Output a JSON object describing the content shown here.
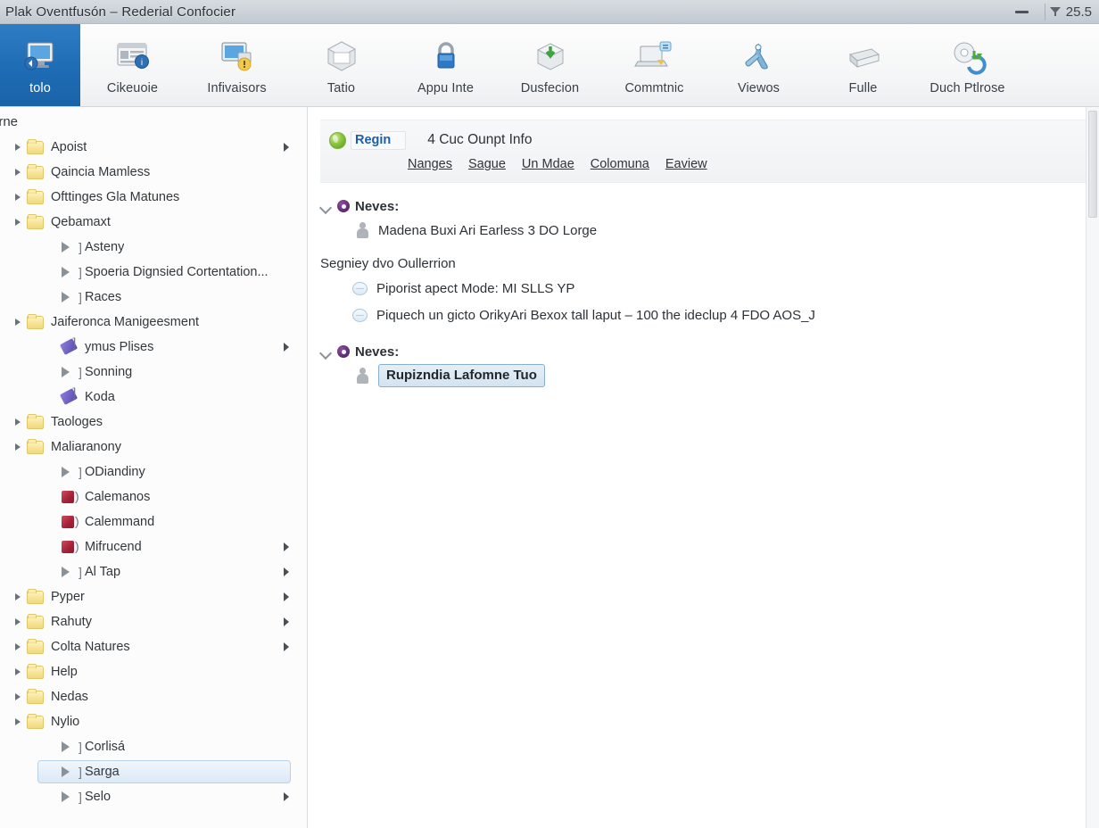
{
  "window": {
    "title": "Plak Oventfusón  –  Rederial Confocier",
    "minimize_label": "—",
    "zoom_value": "25.5",
    "filter_icon": "funnel-icon",
    "minimize_icon": "minimize-icon"
  },
  "toolbar": {
    "items": [
      {
        "label": "tolo",
        "icon": "monitor-blue-icon",
        "selected": true
      },
      {
        "label": "Cikeuoie",
        "icon": "document-info-icon",
        "selected": false
      },
      {
        "label": "Infivaisors",
        "icon": "monitor-alert-icon",
        "selected": false
      },
      {
        "label": "Tatio",
        "icon": "box-gray-icon",
        "selected": false
      },
      {
        "label": "Appu Inte",
        "icon": "lock-blue-icon",
        "selected": false
      },
      {
        "label": "Dusfecion",
        "icon": "box-download-icon",
        "selected": false
      },
      {
        "label": "Commtnic",
        "icon": "laptop-deploy-icon",
        "selected": false
      },
      {
        "label": "Viewos",
        "icon": "wrench-blue-icon",
        "selected": false
      },
      {
        "label": "Fulle",
        "icon": "server-gray-icon",
        "selected": false
      },
      {
        "label": "Duch Ptlrose",
        "icon": "disc-refresh-icon",
        "selected": false
      }
    ]
  },
  "sidebar": {
    "header": "erne",
    "nodes": [
      {
        "label": "Apoist",
        "icon": "folder-icon",
        "indent": 0,
        "twist": true,
        "arrow": true
      },
      {
        "label": "Qaincia Mamless",
        "icon": "folder-icon",
        "indent": 0,
        "twist": true,
        "arrow": false
      },
      {
        "label": "Ofttinges Gla Matunes",
        "icon": "folder-icon",
        "indent": 0,
        "twist": true,
        "arrow": false
      },
      {
        "label": "Qebamaxt",
        "icon": "folder-icon",
        "indent": 0,
        "twist": true,
        "arrow": false
      },
      {
        "label": "Asteny",
        "icon": "triangle-icon",
        "indent": 1,
        "twist": false,
        "arrow": false
      },
      {
        "label": "Spoeria Dignsied Cortentation...",
        "icon": "triangle-icon",
        "indent": 1,
        "twist": false,
        "arrow": false
      },
      {
        "label": "Races",
        "icon": "triangle-icon",
        "indent": 1,
        "twist": false,
        "arrow": false
      },
      {
        "label": "Jaiferonca Manigeesment",
        "icon": "folder-icon",
        "indent": 0,
        "twist": true,
        "arrow": false
      },
      {
        "label": "ymus Plises",
        "icon": "pen-icon",
        "indent": 1,
        "twist": false,
        "arrow": true
      },
      {
        "label": "Sonning",
        "icon": "triangle-icon",
        "indent": 1,
        "twist": false,
        "arrow": false
      },
      {
        "label": "Koda",
        "icon": "pen-icon",
        "indent": 1,
        "twist": false,
        "arrow": false
      },
      {
        "label": "Taologes",
        "icon": "folder-icon",
        "indent": 0,
        "twist": true,
        "arrow": false
      },
      {
        "label": "Maliaranony",
        "icon": "folder-icon",
        "indent": 0,
        "twist": true,
        "arrow": false
      },
      {
        "label": "ODiandiny",
        "icon": "triangle-icon",
        "indent": 1,
        "twist": false,
        "arrow": false
      },
      {
        "label": "Calemanos",
        "icon": "red-icon",
        "indent": 1,
        "twist": false,
        "arrow": false
      },
      {
        "label": "Calemmand",
        "icon": "red-icon",
        "indent": 1,
        "twist": false,
        "arrow": false
      },
      {
        "label": "Mifrucend",
        "icon": "red-icon",
        "indent": 1,
        "twist": false,
        "arrow": true
      },
      {
        "label": "Al Tap",
        "icon": "triangle-icon",
        "indent": 1,
        "twist": false,
        "arrow": true
      },
      {
        "label": "Pyper",
        "icon": "folder-icon",
        "indent": 0,
        "twist": true,
        "arrow": true
      },
      {
        "label": "Rahuty",
        "icon": "folder-icon",
        "indent": 0,
        "twist": true,
        "arrow": true
      },
      {
        "label": "Colta Natures",
        "icon": "folder-icon",
        "indent": 0,
        "twist": true,
        "arrow": true
      },
      {
        "label": "Help",
        "icon": "folder-icon",
        "indent": 0,
        "twist": true,
        "arrow": false
      },
      {
        "label": "Nedas",
        "icon": "folder-icon",
        "indent": 0,
        "twist": true,
        "arrow": false
      },
      {
        "label": "Nylio",
        "icon": "folder-icon",
        "indent": 0,
        "twist": true,
        "arrow": false
      },
      {
        "label": "Corlisá",
        "icon": "triangle-icon",
        "indent": 1,
        "twist": false,
        "arrow": false
      },
      {
        "label": "Sarga",
        "icon": "triangle-icon",
        "indent": 1,
        "twist": false,
        "arrow": false,
        "selected": true
      },
      {
        "label": "Selo",
        "icon": "triangle-icon",
        "indent": 1,
        "twist": false,
        "arrow": true
      }
    ]
  },
  "content": {
    "header": {
      "globe_icon": "globe-green-icon",
      "region_chip": "Regin",
      "title": "4 Cuc Ounpt Info",
      "links": [
        "Nanges",
        "Sague",
        "Un Mdae",
        "Colomuna",
        "Eaview"
      ]
    },
    "sections": [
      {
        "kind": "collapsible",
        "chevron_icon": "chevron-down-icon",
        "gear_icon": "gear-purple-icon",
        "title": "Neves:",
        "items": [
          {
            "label": "Madena Buxi Ari Earless 3 DO Lorge",
            "icon": "figure-icon",
            "selected": false
          }
        ]
      },
      {
        "kind": "plain",
        "title": "Segniey dvo Oullerrion",
        "items": [
          {
            "label": "Piporist apect Mode: MI SLLS YP",
            "icon": "oval-icon"
          },
          {
            "label": "Piquech un gicto OrikyAri Bexox tall laput – 100 the ideclup 4 FDO AOS_J",
            "icon": "oval-icon"
          }
        ]
      },
      {
        "kind": "collapsible",
        "chevron_icon": "chevron-down-icon",
        "gear_icon": "gear-purple-icon",
        "title": "Neves:",
        "items": [
          {
            "label": "Rupizndia Lafomne Tuo",
            "icon": "figure-icon",
            "selected": true
          }
        ]
      }
    ]
  },
  "scrollbar": {
    "orientation": "vertical"
  }
}
